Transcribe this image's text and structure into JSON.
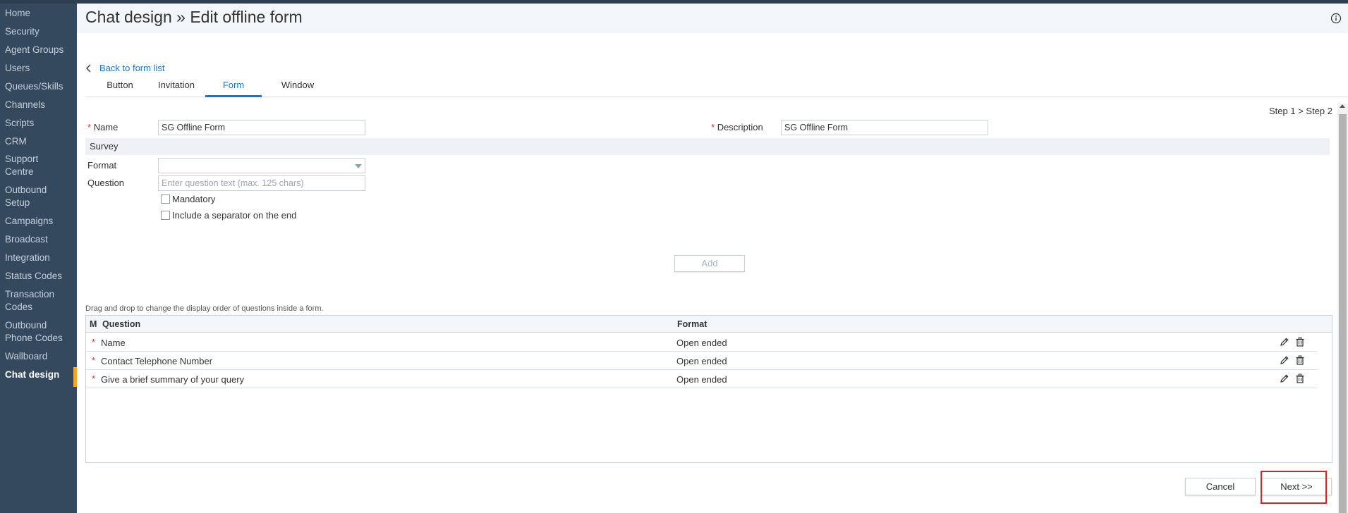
{
  "sidebar": {
    "items": [
      {
        "label": "Home"
      },
      {
        "label": "Security"
      },
      {
        "label": "Agent Groups"
      },
      {
        "label": "Users"
      },
      {
        "label": "Queues/Skills"
      },
      {
        "label": "Channels"
      },
      {
        "label": "Scripts"
      },
      {
        "label": "CRM"
      },
      {
        "label": "Support Centre"
      },
      {
        "label": "Outbound Setup"
      },
      {
        "label": "Campaigns"
      },
      {
        "label": "Broadcast"
      },
      {
        "label": "Integration"
      },
      {
        "label": "Status Codes"
      },
      {
        "label": "Transaction Codes"
      },
      {
        "label": "Outbound Phone Codes"
      },
      {
        "label": "Wallboard"
      },
      {
        "label": "Chat design"
      }
    ],
    "active": "Chat design",
    "accent_color": "#f5a623"
  },
  "header": {
    "title": "Chat design » Edit offline form",
    "info_icon": "info-icon"
  },
  "nav": {
    "back_label": "Back to form list"
  },
  "tabs": [
    {
      "label": "Button"
    },
    {
      "label": "Invitation"
    },
    {
      "label": "Form"
    },
    {
      "label": "Window"
    }
  ],
  "active_tab": "Form",
  "steps": {
    "current": "Step 1",
    "separator": ">",
    "next": "Step 2"
  },
  "form": {
    "required_mark": "*",
    "name_label": "Name",
    "name_value": "SG Offline Form",
    "description_label": "Description",
    "description_value": "SG Offline Form",
    "survey_label": "Survey",
    "format_label": "Format",
    "format_value": "",
    "question_label": "Question",
    "question_placeholder": "Enter question text (max. 125 chars)",
    "mandatory_label": "Mandatory",
    "mandatory_checked": false,
    "separator_label": "Include a separator on the end",
    "separator_checked": false,
    "add_label": "Add"
  },
  "questions": {
    "hint": "Drag and drop to change the display order of questions inside a form.",
    "columns": {
      "m": "M",
      "question": "Question",
      "format": "Format"
    },
    "rows": [
      {
        "mandatory": "*",
        "question": "Name",
        "format": "Open ended"
      },
      {
        "mandatory": "*",
        "question": "Contact Telephone Number",
        "format": "Open ended"
      },
      {
        "mandatory": "*",
        "question": "Give a brief summary of your query",
        "format": "Open ended"
      }
    ]
  },
  "footer": {
    "cancel_label": "Cancel",
    "next_label": "Next >>"
  },
  "colors": {
    "link": "#1a73c7",
    "required": "#d9302c",
    "highlight": "#e02020"
  }
}
